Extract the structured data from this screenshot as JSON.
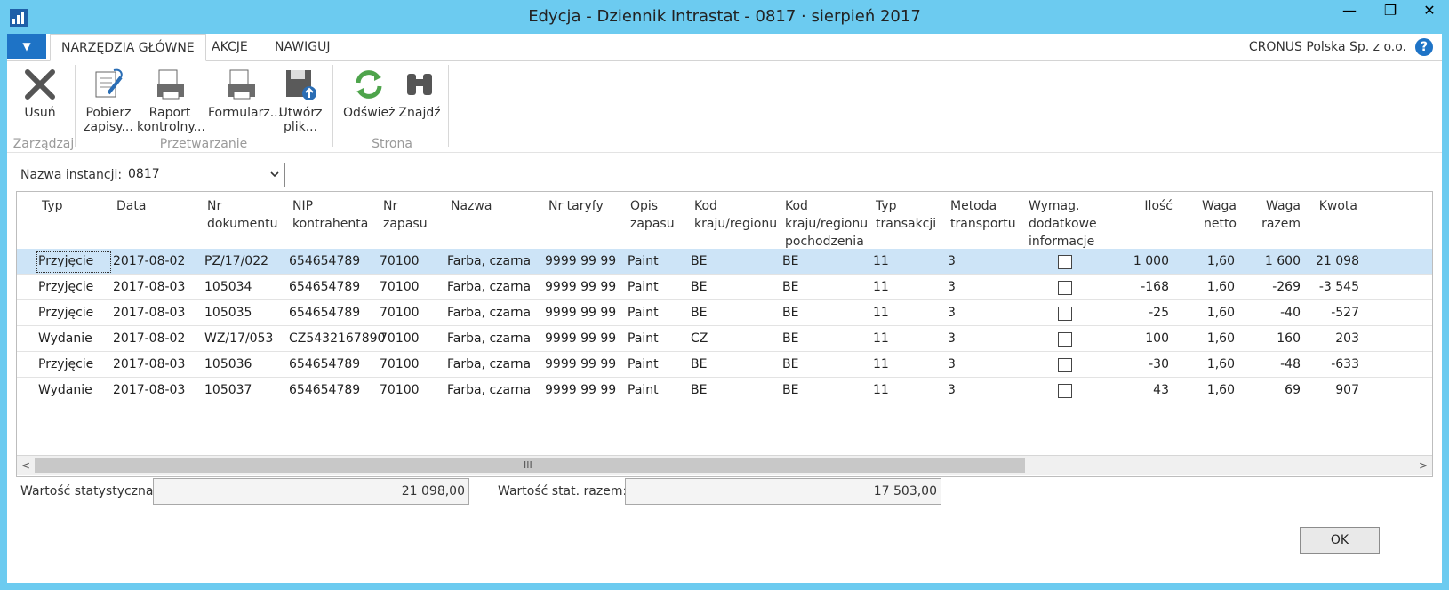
{
  "window": {
    "title": "Edycja - Dziennik Intrastat - 0817 · sierpień 2017",
    "minimize": "—",
    "maximize": "❐",
    "close": "✕"
  },
  "ribbon": {
    "menu_arrow": "▼",
    "tabs": [
      "NARZĘDZIA GŁÓWNE",
      "AKCJE",
      "NAWIGUJ"
    ],
    "company": "CRONUS Polska Sp. z o.o.",
    "help": "?",
    "buttons": {
      "delete": [
        "Usuń"
      ],
      "get_entries": [
        "Pobierz",
        "zapisy..."
      ],
      "checklist_report": [
        "Raport",
        "kontrolny..."
      ],
      "form": [
        "Formularz..."
      ],
      "create_file": [
        "Utwórz",
        "plik..."
      ],
      "refresh": [
        "Odśwież"
      ],
      "find": [
        "Znajdź"
      ]
    },
    "groups": [
      "Zarządzaj",
      "Przetwarzanie",
      "Strona"
    ]
  },
  "instance": {
    "label": "Nazwa instancji:",
    "value": "0817"
  },
  "grid": {
    "headers": [
      [
        "Typ"
      ],
      [
        "Data"
      ],
      [
        "Nr",
        "dokumentu"
      ],
      [
        "NIP",
        "kontrahenta"
      ],
      [
        "Nr",
        "zapasu"
      ],
      [
        "Nazwa"
      ],
      [
        "Nr taryfy"
      ],
      [
        "Opis",
        "zapasu"
      ],
      [
        "Kod",
        "kraju/regionu"
      ],
      [
        "Kod",
        "kraju/regionu",
        "pochodzenia"
      ],
      [
        "Typ",
        "transakcji"
      ],
      [
        "Metoda",
        "transportu"
      ],
      [
        "Wymag.",
        "dodatkowe",
        "informacje"
      ],
      [
        "Ilość"
      ],
      [
        "Waga",
        "netto"
      ],
      [
        "Waga",
        "razem"
      ],
      [
        "Kwota"
      ]
    ],
    "rows": [
      [
        "Przyjęcie",
        "2017-08-02",
        "PZ/17/022",
        "654654789",
        "70100",
        "Farba, czarna",
        "9999 99 99",
        "Paint",
        "BE",
        "BE",
        "11",
        "3",
        "",
        "1 000",
        "1,60",
        "1 600",
        "21 098"
      ],
      [
        "Przyjęcie",
        "2017-08-03",
        "105034",
        "654654789",
        "70100",
        "Farba, czarna",
        "9999 99 99",
        "Paint",
        "BE",
        "BE",
        "11",
        "3",
        "",
        "-168",
        "1,60",
        "-269",
        "-3 545"
      ],
      [
        "Przyjęcie",
        "2017-08-03",
        "105035",
        "654654789",
        "70100",
        "Farba, czarna",
        "9999 99 99",
        "Paint",
        "BE",
        "BE",
        "11",
        "3",
        "",
        "-25",
        "1,60",
        "-40",
        "-527"
      ],
      [
        "Wydanie",
        "2017-08-02",
        "WZ/17/053",
        "CZ5432167890",
        "70100",
        "Farba, czarna",
        "9999 99 99",
        "Paint",
        "CZ",
        "BE",
        "11",
        "3",
        "",
        "100",
        "1,60",
        "160",
        "203"
      ],
      [
        "Przyjęcie",
        "2017-08-03",
        "105036",
        "654654789",
        "70100",
        "Farba, czarna",
        "9999 99 99",
        "Paint",
        "BE",
        "BE",
        "11",
        "3",
        "",
        "-30",
        "1,60",
        "-48",
        "-633"
      ],
      [
        "Wydanie",
        "2017-08-03",
        "105037",
        "654654789",
        "70100",
        "Farba, czarna",
        "9999 99 99",
        "Paint",
        "BE",
        "BE",
        "11",
        "3",
        "",
        "43",
        "1,60",
        "69",
        "907"
      ]
    ],
    "checkbox_values": [
      false,
      false,
      false,
      false,
      false,
      false
    ],
    "selected_row": 0,
    "scroll_left": "<",
    "scroll_right": ">",
    "scroll_grip": "III"
  },
  "totals": {
    "stat_value_label": "Wartość statystyczna:",
    "stat_value": "21 098,00",
    "stat_total_label": "Wartość stat. razem:",
    "stat_total": "17 503,00"
  },
  "footer": {
    "ok": "OK"
  },
  "colors": {
    "title_bar": "#6ccbf0",
    "accent": "#1e73c6",
    "selected_row": "#cde4f7"
  }
}
